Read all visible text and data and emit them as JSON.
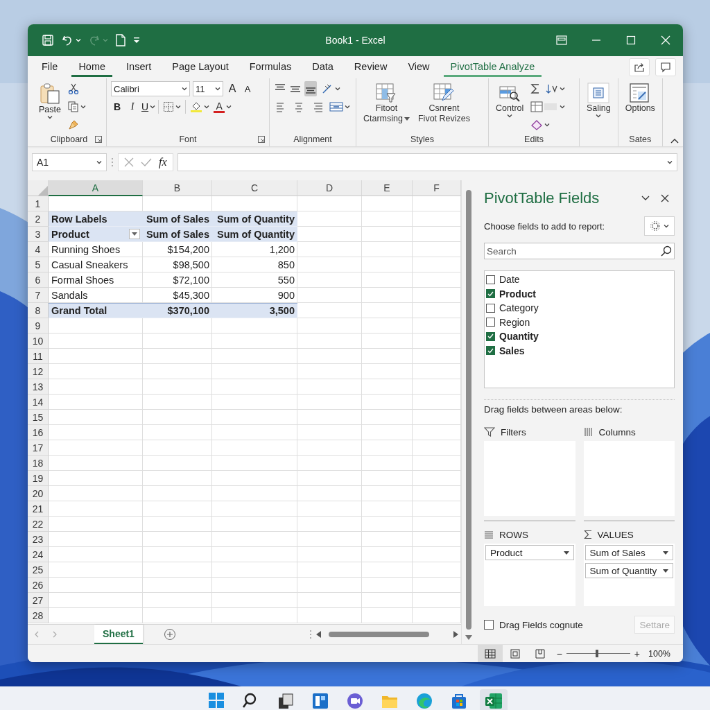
{
  "window": {
    "title": "Book1 - Excel"
  },
  "quick_access": {
    "redo_disabled": true
  },
  "ribbon": {
    "tabs": [
      {
        "label": "File",
        "selected": false,
        "contextual": false
      },
      {
        "label": "Home",
        "selected": true,
        "contextual": false
      },
      {
        "label": "Insert",
        "selected": false,
        "contextual": false
      },
      {
        "label": "Page Layout",
        "selected": false,
        "contextual": false
      },
      {
        "label": "Formulas",
        "selected": false,
        "contextual": false
      },
      {
        "label": "Data",
        "selected": false,
        "contextual": false
      },
      {
        "label": "Review",
        "selected": false,
        "contextual": false
      },
      {
        "label": "View",
        "selected": false,
        "contextual": false
      },
      {
        "label": "PivotTable Analyze",
        "selected": false,
        "contextual": true
      }
    ],
    "groups": [
      {
        "kind": "clipboard",
        "label": "Clipboard",
        "launcher": true,
        "paste_label": "Paste"
      },
      {
        "kind": "font",
        "label": "Font",
        "launcher": true,
        "font_name": "Calibri",
        "font_size": "11",
        "grow": "A",
        "shrink": "A",
        "bold": "B",
        "italic": "I",
        "underline": "U",
        "font_color": "A"
      },
      {
        "kind": "alignment",
        "label": "Alignment",
        "vertical_align": [
          {
            "selected": false
          },
          {
            "selected": false
          },
          {
            "selected": true
          }
        ]
      },
      {
        "kind": "buttons",
        "label": "Styles",
        "buttons": [
          {
            "kind": "filter",
            "lines": [
              "Fitoot",
              "Ctarmsing"
            ],
            "dropdown": true
          },
          {
            "kind": "edit",
            "lines": [
              "Csnrent",
              "Fivot Revizes"
            ]
          }
        ]
      },
      {
        "kind": "edits",
        "label": "Edits",
        "buttons": [
          {
            "kind": "lookup",
            "lines": [
              "Control"
            ],
            "dropdown": true
          }
        ]
      },
      {
        "kind": "buttons",
        "buttons": [
          {
            "kind": "frame",
            "lines": [
              "Saling"
            ],
            "dropdown": true
          }
        ]
      },
      {
        "kind": "buttons",
        "label": "Sates",
        "buttons": [
          {
            "kind": "options",
            "lines": [
              "Options"
            ]
          }
        ]
      }
    ]
  },
  "formula_bar": {
    "name_box": "A1",
    "function_label": "fx"
  },
  "sheet": {
    "columns": [
      {
        "label": "A",
        "selected": true
      },
      {
        "label": "B",
        "selected": false
      },
      {
        "label": "C",
        "selected": false
      },
      {
        "label": "D",
        "selected": false
      },
      {
        "label": "E",
        "selected": false
      },
      {
        "label": "F",
        "selected": false
      }
    ],
    "rows": [
      {
        "number": "1",
        "kind": "blank"
      },
      {
        "number": "2",
        "kind": "header",
        "cells": [
          "Row Labels",
          "Sum of Sales",
          "Sum of Quantity"
        ]
      },
      {
        "number": "3",
        "kind": "field",
        "cells": [
          "Product",
          "Sum of Sales",
          "Sum of Quantity"
        ]
      },
      {
        "number": "4",
        "kind": "item",
        "cells": [
          "Running Shoes",
          "$154,200",
          "1,200"
        ]
      },
      {
        "number": "5",
        "kind": "item",
        "cells": [
          "Casual Sneakers",
          "$98,500",
          "850"
        ]
      },
      {
        "number": "6",
        "kind": "item",
        "cells": [
          "Formal Shoes",
          "$72,100",
          "550"
        ]
      },
      {
        "number": "7",
        "kind": "item",
        "cells": [
          "Sandals",
          "$45,300",
          "900"
        ]
      },
      {
        "number": "8",
        "kind": "total",
        "cells": [
          "Grand Total",
          "$370,100",
          "3,500"
        ]
      },
      {
        "number": "9",
        "kind": "blank"
      },
      {
        "number": "10",
        "kind": "blank"
      },
      {
        "number": "11",
        "kind": "blank"
      },
      {
        "number": "12",
        "kind": "blank"
      },
      {
        "number": "13",
        "kind": "blank"
      },
      {
        "number": "14",
        "kind": "blank"
      },
      {
        "number": "15",
        "kind": "blank"
      },
      {
        "number": "16",
        "kind": "blank"
      },
      {
        "number": "17",
        "kind": "blank"
      },
      {
        "number": "18",
        "kind": "blank"
      },
      {
        "number": "19",
        "kind": "blank"
      },
      {
        "number": "20",
        "kind": "blank"
      },
      {
        "number": "21",
        "kind": "blank"
      },
      {
        "number": "22",
        "kind": "blank"
      },
      {
        "number": "23",
        "kind": "blank"
      },
      {
        "number": "24",
        "kind": "blank"
      },
      {
        "number": "25",
        "kind": "blank"
      },
      {
        "number": "26",
        "kind": "blank"
      },
      {
        "number": "27",
        "kind": "blank"
      },
      {
        "number": "28",
        "kind": "blank"
      }
    ]
  },
  "sheet_tabs": [
    {
      "label": "Sheet1",
      "selected": true
    }
  ],
  "pane": {
    "title": "PivotTable Fields",
    "prompt": "Choose fields to add to report:",
    "search": {
      "placeholder": "Search"
    },
    "fields": [
      {
        "name": "Date",
        "checked": false
      },
      {
        "name": "Product",
        "checked": true
      },
      {
        "name": "Category",
        "checked": false
      },
      {
        "name": "Region",
        "checked": false
      },
      {
        "name": "Quantity",
        "checked": true
      },
      {
        "name": "Sales",
        "checked": true
      }
    ],
    "areas_prompt": "Drag fields between areas below:",
    "areas": [
      {
        "kind": "filters",
        "title": "Filters"
      },
      {
        "kind": "columns",
        "title": "Columns"
      },
      {
        "kind": "rows",
        "title": "ROWS",
        "items": [
          "Product"
        ]
      },
      {
        "kind": "values",
        "title": "VALUES",
        "items": [
          "Sum of Sales",
          "Sum of Quantity"
        ]
      }
    ],
    "defer": {
      "label": "Drag Fields cognute",
      "checked": false
    },
    "update_button": {
      "label": "Settare",
      "disabled": true
    }
  },
  "status_bar": {
    "views": [
      {
        "selected": true
      },
      {
        "selected": false
      },
      {
        "selected": false
      }
    ],
    "minus": "−",
    "plus": "+",
    "zoom": {
      "level": 0.48,
      "reading": "100%"
    }
  },
  "taskbar": {
    "apps": [
      {
        "kind": "start",
        "active": false
      },
      {
        "kind": "search",
        "active": false
      },
      {
        "kind": "taskview",
        "active": false
      },
      {
        "kind": "widgets",
        "active": false
      },
      {
        "kind": "chat",
        "active": false
      },
      {
        "kind": "folder",
        "active": false
      },
      {
        "kind": "browser",
        "active": false
      },
      {
        "kind": "store",
        "active": false
      },
      {
        "kind": "sheet",
        "active": true
      }
    ]
  }
}
